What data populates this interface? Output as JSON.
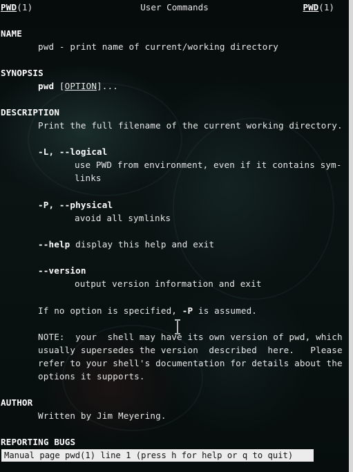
{
  "header": {
    "left_name": "PWD",
    "left_section": "(1)",
    "center": "User Commands",
    "right_name": "PWD",
    "right_section": "(1)"
  },
  "sections": {
    "name_heading": "NAME",
    "name_text": "pwd - print name of current/working directory",
    "synopsis_heading": "SYNOPSIS",
    "synopsis_cmd": "pwd",
    "synopsis_open": " [",
    "synopsis_option": "OPTION",
    "synopsis_close": "]...",
    "description_heading": "DESCRIPTION",
    "description_text": "Print the full filename of the current working directory.",
    "opt_logical_flag": "-L, --logical",
    "opt_logical_desc1": "use PWD from environment, even if it contains sym-",
    "opt_logical_desc2": "links",
    "opt_physical_flag": "-P, --physical",
    "opt_physical_desc": "avoid all symlinks",
    "opt_help_flag": "--help",
    "opt_help_desc": " display this help and exit",
    "opt_version_flag": "--version",
    "opt_version_desc": "output version information and exit",
    "default_pre": "If no option is specified, ",
    "default_flag": "-P",
    "default_post": " is assumed.",
    "note1": "NOTE:  your  shell may have its own version of pwd, which",
    "note2": "usually supersedes the version  described  here.   Please",
    "note3": "refer to your shell's documentation for details about the",
    "note4": "options it supports.",
    "author_heading": "AUTHOR",
    "author_text": "Written by Jim Meyering.",
    "bugs_heading": "REPORTING BUGS"
  },
  "status_bar": {
    "text": "Manual page pwd(1) line 1 (press h for help or q to quit)"
  }
}
